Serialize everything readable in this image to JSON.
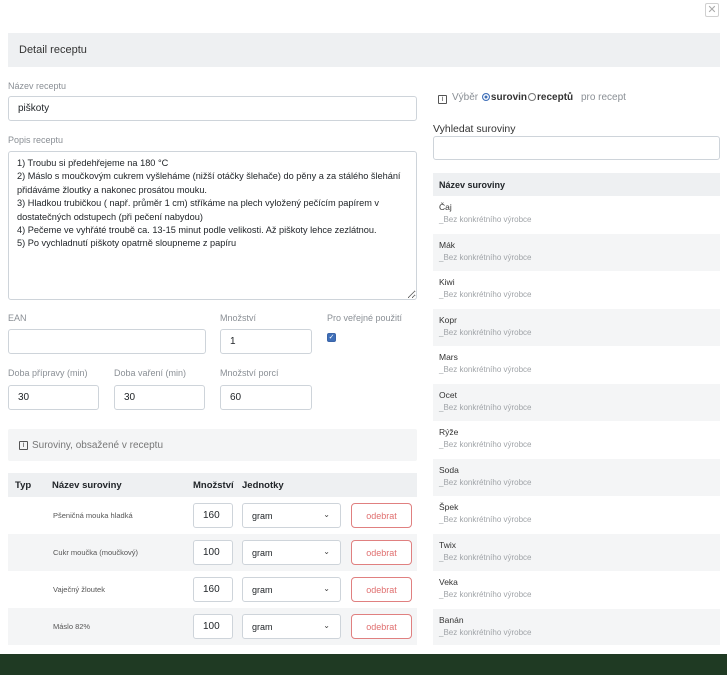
{
  "modal": {
    "title": "Detail receptu",
    "close_icon": "close-icon"
  },
  "form": {
    "name_label": "Název receptu",
    "name_value": "piškoty",
    "desc_label": "Popis receptu",
    "desc_value": "1) Troubu si předehřejeme na 180 °C\n2) Máslo s moučkovým cukrem vyšleháme (nižší otáčky šlehače) do pěny a za stálého šlehání přidáváme žloutky a nakonec prosátou mouku.\n3) Hladkou trubičkou ( např. průměr 1 cm) stříkáme na plech vyložený pečícím papírem v dostatečných odstupech (při pečení nabydou)\n4) Pečeme ve vyhřáté troubě ca. 13-15 minut podle velikosti. Až piškoty lehce zezlátnou.\n5) Po vychladnutí piškoty opatrně sloupneme z papíru",
    "ean_label": "EAN",
    "ean_value": "",
    "amount_label": "Množství",
    "amount_value": "1",
    "public_label": "Pro veřejné použití",
    "public_checked": true,
    "prep_label": "Doba přípravy (min)",
    "prep_value": "30",
    "cook_label": "Doba vaření (min)",
    "cook_value": "30",
    "portions_label": "Množství porcí",
    "portions_value": "60"
  },
  "ingredients_section": {
    "info_text": "Suroviny, obsažené v receptu",
    "columns": [
      "Typ",
      "Název suroviny",
      "Množství",
      "Jednotky"
    ],
    "rows": [
      {
        "type": "",
        "name": "Pšeničná mouka hladká",
        "qty": "160",
        "unit": "gram",
        "action": "odebrat"
      },
      {
        "type": "",
        "name": "Cukr moučka (moučkový)",
        "qty": "100",
        "unit": "gram",
        "action": "odebrat"
      },
      {
        "type": "",
        "name": "Vaječný žloutek",
        "qty": "160",
        "unit": "gram",
        "action": "odebrat"
      },
      {
        "type": "",
        "name": "Máslo 82%",
        "qty": "100",
        "unit": "gram",
        "action": "odebrat"
      }
    ]
  },
  "picker": {
    "prefix": "Výběr",
    "option_a": "surovin",
    "option_b": "receptů",
    "suffix": "pro recept",
    "selected": "surovin",
    "search_label": "Vyhledat suroviny",
    "search_value": "",
    "list_header": "Název suroviny",
    "items": [
      {
        "name": "Čaj",
        "sub": "_Bez konkrétního výrobce"
      },
      {
        "name": "Mák",
        "sub": "_Bez konkrétního výrobce"
      },
      {
        "name": "Kiwi",
        "sub": "_Bez konkrétního výrobce"
      },
      {
        "name": "Kopr",
        "sub": "_Bez konkrétního výrobce"
      },
      {
        "name": "Mars",
        "sub": "_Bez konkrétního výrobce"
      },
      {
        "name": "Ocet",
        "sub": "_Bez konkrétního výrobce"
      },
      {
        "name": "Rýže",
        "sub": "_Bez konkrétního výrobce"
      },
      {
        "name": "Soda",
        "sub": "_Bez konkrétního výrobce"
      },
      {
        "name": "Špek",
        "sub": "_Bez konkrétního výrobce"
      },
      {
        "name": "Twix",
        "sub": "_Bez konkrétního výrobce"
      },
      {
        "name": "Veka",
        "sub": "_Bez konkrétního výrobce"
      },
      {
        "name": "Banán",
        "sub": "_Bez konkrétního výrobce"
      }
    ]
  },
  "colors": {
    "backdrop": "#1f3a23",
    "accent": "#3f6fb8",
    "danger": "#e07070"
  }
}
